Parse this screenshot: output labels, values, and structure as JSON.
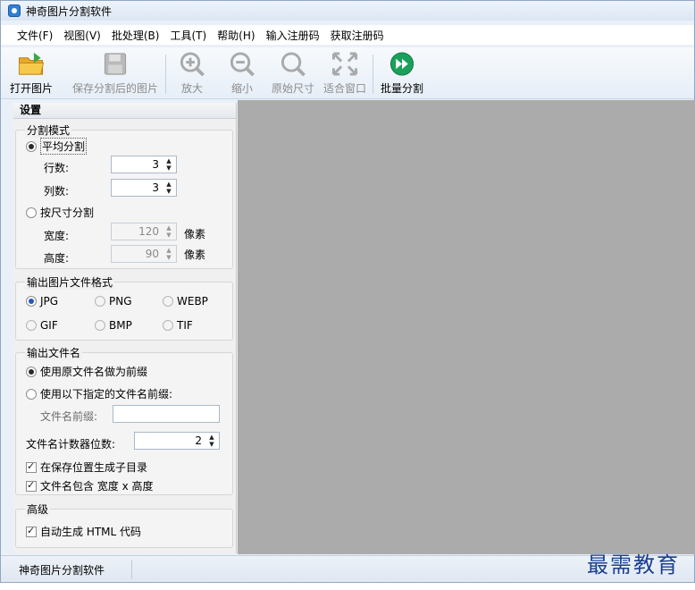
{
  "window": {
    "title": "神奇图片分割软件"
  },
  "menu": [
    "文件(F)",
    "视图(V)",
    "批处理(B)",
    "工具(T)",
    "帮助(H)",
    "输入注册码",
    "获取注册码"
  ],
  "toolbar": {
    "open": "打开图片",
    "save": "保存分割后的图片",
    "zoom_in": "放大",
    "zoom_out": "缩小",
    "original": "原始尺寸",
    "fit": "适合窗口",
    "batch": "批量分割"
  },
  "settings": {
    "header": "设置",
    "split_mode": {
      "title": "分割模式",
      "even": "平均分割",
      "rows_label": "行数:",
      "rows_value": "3",
      "cols_label": "列数:",
      "cols_value": "3",
      "by_size": "按尺寸分割",
      "width_label": "宽度:",
      "width_value": "120",
      "height_label": "高度:",
      "height_value": "90",
      "unit": "像素"
    },
    "format": {
      "title": "输出图片文件格式",
      "options": [
        "JPG",
        "PNG",
        "WEBP",
        "GIF",
        "BMP",
        "TIF"
      ],
      "selected": "JPG"
    },
    "filename": {
      "title": "输出文件名",
      "use_original": "使用原文件名做为前缀",
      "use_custom": "使用以下指定的文件名前缀:",
      "prefix_label": "文件名前缀:",
      "prefix_value": "",
      "counter_label": "文件名计数器位数:",
      "counter_value": "2",
      "subdir": "在保存位置生成子目录",
      "include_size": "文件名包含 宽度 x 高度"
    },
    "advanced": {
      "title": "高级",
      "html": "自动生成 HTML 代码"
    }
  },
  "status": {
    "text": "神奇图片分割软件"
  },
  "watermark": "最需教育",
  "colors": {
    "canvas": "#ababab",
    "accent": "#2f7fd6",
    "batch_green": "#1aa05a"
  },
  "icons": [
    "folder-open-icon",
    "floppy-disk-icon",
    "zoom-in-icon",
    "zoom-out-icon",
    "magnifier-icon",
    "fit-window-icon",
    "play-forward-icon"
  ]
}
